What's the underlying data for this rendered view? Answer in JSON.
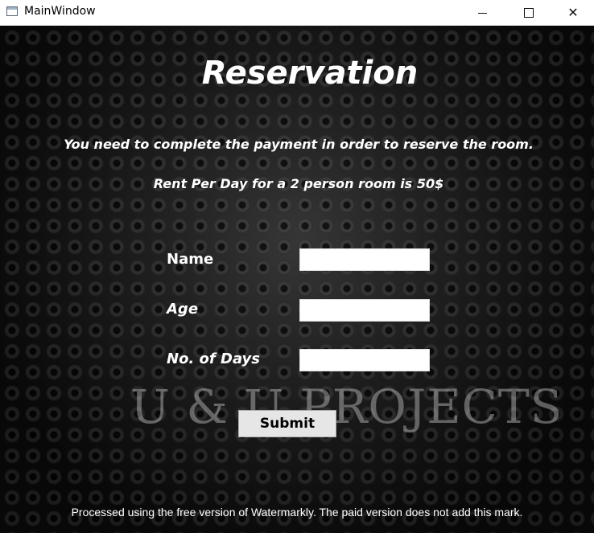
{
  "window": {
    "title": "MainWindow",
    "controls": {
      "minimize_icon": "minimize-icon",
      "maximize_icon": "maximize-icon",
      "close_glyph": "✕"
    }
  },
  "form": {
    "heading": "Reservation",
    "info_line_1": "You need to complete the payment in order to reserve the room.",
    "info_line_2": "Rent Per Day for a 2 person room is 50$",
    "fields": {
      "name_label": "Name",
      "name_value": "",
      "age_label": "Age",
      "age_value": "",
      "days_label": "No. of Days",
      "days_value": ""
    },
    "submit_label": "Submit"
  },
  "overlays": {
    "brand_watermark": "U & U PROJECTS",
    "tool_notice": "Processed using the free version of Watermarkly. The paid version does not add this mark."
  },
  "colors": {
    "background": "#1c1c1c",
    "text": "#ffffff",
    "button": "#e6e6e6"
  }
}
